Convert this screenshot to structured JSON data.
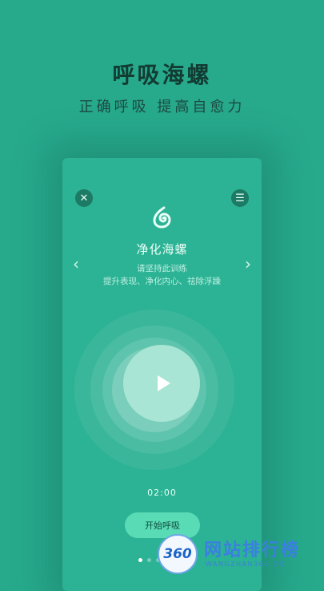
{
  "header": {
    "title": "呼吸海螺",
    "subtitle": "正确呼吸  提高自愈力"
  },
  "card": {
    "close_icon": "close-icon",
    "menu_icon": "menu-icon",
    "logo_icon": "conch-shell-icon",
    "title": "净化海螺",
    "description_line1": "请坚持此训练",
    "description_line2": "提升表现、净化内心、祛除浮躁",
    "prev_arrow": "‹",
    "next_arrow": "›",
    "play_icon": "play-icon",
    "timer": "02:00",
    "start_button": "开始呼吸",
    "pagination_dots": 4,
    "active_dot": 0
  },
  "watermark": {
    "logo_text": "360",
    "title": "网站排行榜",
    "domain": "WANGZHAN360.CN"
  },
  "colors": {
    "background": "#27a98c",
    "card": "#2cb294",
    "button": "#59dbb6",
    "play_circle": "#a8e5d4"
  }
}
